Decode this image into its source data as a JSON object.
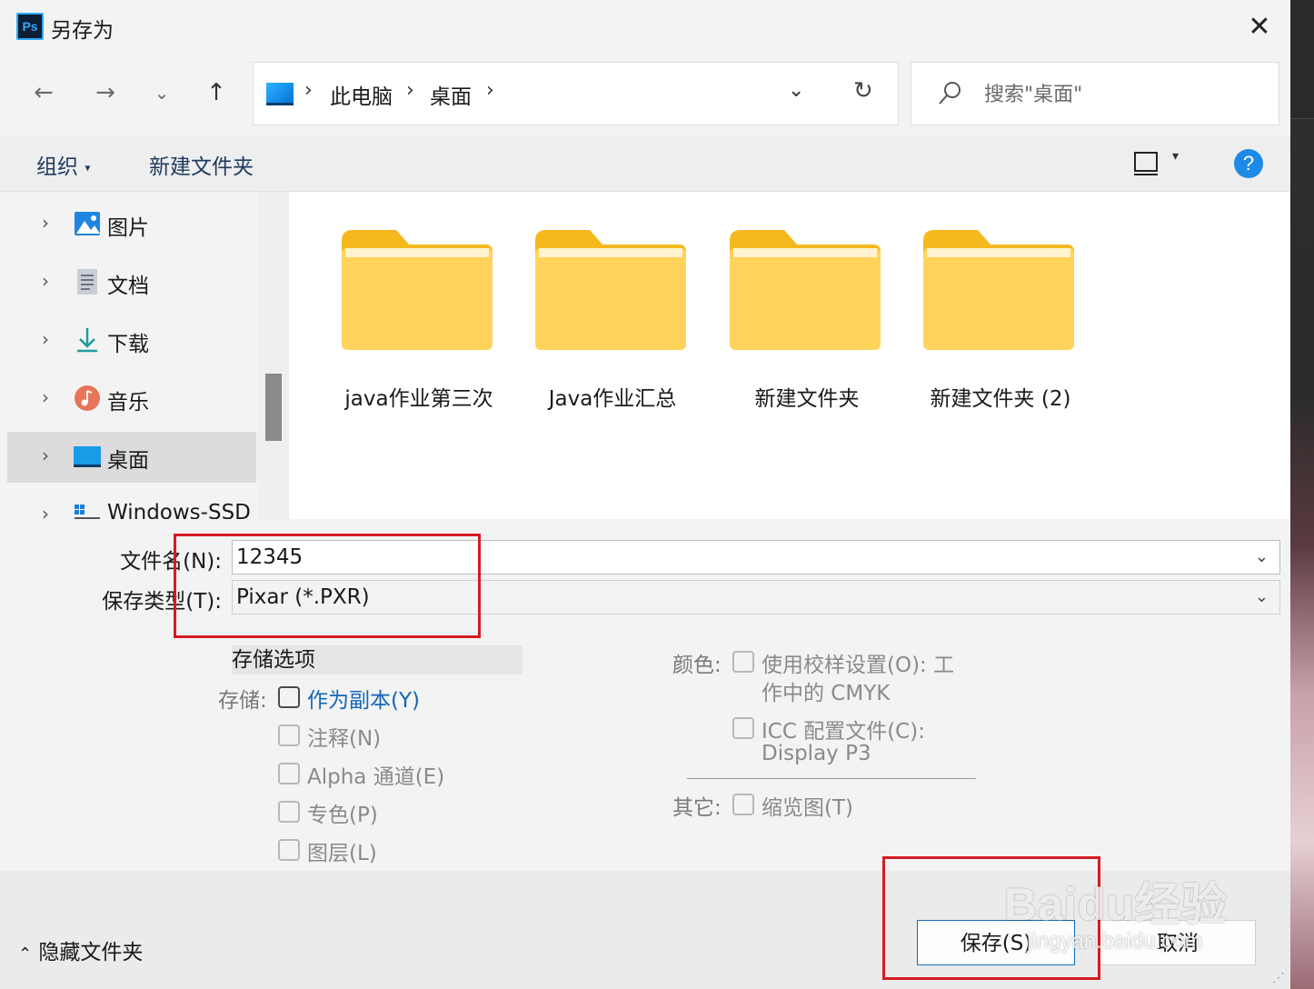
{
  "window": {
    "title": "另存为",
    "app_icon": "Ps"
  },
  "nav": {
    "back": "←",
    "forward": "→",
    "recent": "⌄",
    "up": "↑"
  },
  "address": {
    "crumbs": [
      "此电脑",
      "桌面"
    ],
    "separator": "›"
  },
  "search": {
    "placeholder": "搜索\"桌面\""
  },
  "toolbar": {
    "organize": "组织",
    "new_folder": "新建文件夹",
    "help": "?"
  },
  "sidebar": {
    "items": [
      {
        "label": "图片",
        "icon": "pictures-icon"
      },
      {
        "label": "文档",
        "icon": "documents-icon"
      },
      {
        "label": "下载",
        "icon": "downloads-icon"
      },
      {
        "label": "音乐",
        "icon": "music-icon"
      },
      {
        "label": "桌面",
        "icon": "desktop-icon",
        "selected": true
      },
      {
        "label": "Windows-SSD",
        "icon": "drive-icon"
      }
    ]
  },
  "folders": [
    {
      "name": "java作业第三次"
    },
    {
      "name": "Java作业汇总"
    },
    {
      "name": "新建文件夹"
    },
    {
      "name": "新建文件夹 (2)"
    }
  ],
  "file": {
    "name_label": "文件名(N):",
    "name_value": "12345",
    "type_label": "保存类型(T):",
    "type_value": "Pixar (*.PXR)"
  },
  "options": {
    "heading": "存储选项",
    "save_label": "存储:",
    "save_items": [
      {
        "label": "作为副本(Y)",
        "enabled": true
      },
      {
        "label": "注释(N)",
        "enabled": false
      },
      {
        "label": "Alpha 通道(E)",
        "enabled": false
      },
      {
        "label": "专色(P)",
        "enabled": false
      },
      {
        "label": "图层(L)",
        "enabled": false
      }
    ],
    "color_label": "颜色:",
    "proof_line1": "使用校样设置(O): 工",
    "proof_line2": "作中的 CMYK",
    "icc_line1": "ICC 配置文件(C):",
    "icc_line2": "Display P3",
    "other_label": "其它:",
    "thumbnail": "缩览图(T)"
  },
  "footer": {
    "hide_folders": "隐藏文件夹",
    "save": "保存(S)",
    "cancel": "取消"
  },
  "watermark": {
    "brand": "Baidu经验",
    "url": "jingyan.baidu.com"
  },
  "colors": {
    "highlight": "#d41b24",
    "link": "#1466b8",
    "help": "#1f8ae6",
    "folder": "#ffd35c"
  }
}
